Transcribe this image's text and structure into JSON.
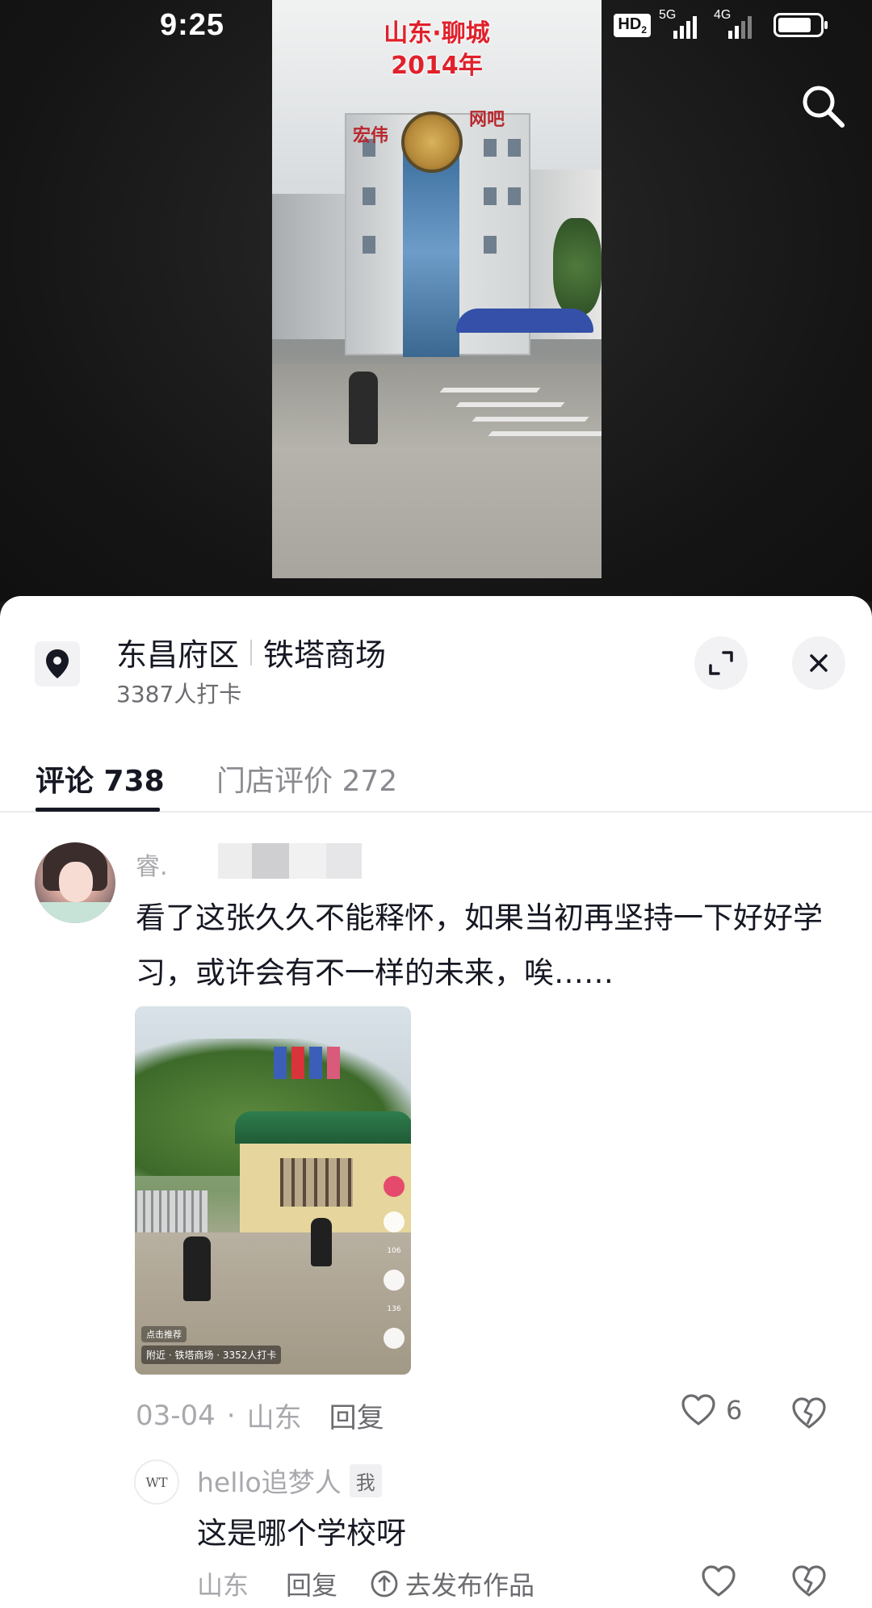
{
  "status_bar": {
    "time": "9:25",
    "hd": "HD",
    "hd_sub": "2",
    "net1": "5G",
    "net2": "4G",
    "battery_level": 0.8
  },
  "video": {
    "overlay_title_line1": "山东·聊城",
    "overlay_title_line2": "2014年",
    "sign_left": "宏伟",
    "sign_right": "网吧"
  },
  "header": {
    "district": "东昌府区",
    "place": "铁塔商场",
    "checkin": "3387人打卡"
  },
  "tabs": [
    {
      "label": "评论 738",
      "active": true
    },
    {
      "label": "门店评价 272",
      "active": false
    }
  ],
  "comment": {
    "username": "睿.",
    "text": "看了这张久久不能释怀，如果当初再坚持一下好好学习，或许会有不一样的未来，唉……",
    "image": {
      "caption_top": "点击推荐",
      "caption_bottom": "附近 · 铁塔商场 · 3352人打卡",
      "side_counts": [
        "106",
        "136"
      ]
    },
    "date": "03-04",
    "region": "山东",
    "reply_label": "回复",
    "likes": "6"
  },
  "reply": {
    "avatar_text": "WT",
    "username": "hello追梦人",
    "me_badge": "我",
    "text": "这是哪个学校呀",
    "region": "山东",
    "reply_label": "回复",
    "publish_label": "去发布作品"
  },
  "colors": {
    "text_primary": "#161823",
    "text_secondary": "#6b6b70",
    "text_muted": "#a8a8ad",
    "overlay_red": "#e0212b"
  }
}
